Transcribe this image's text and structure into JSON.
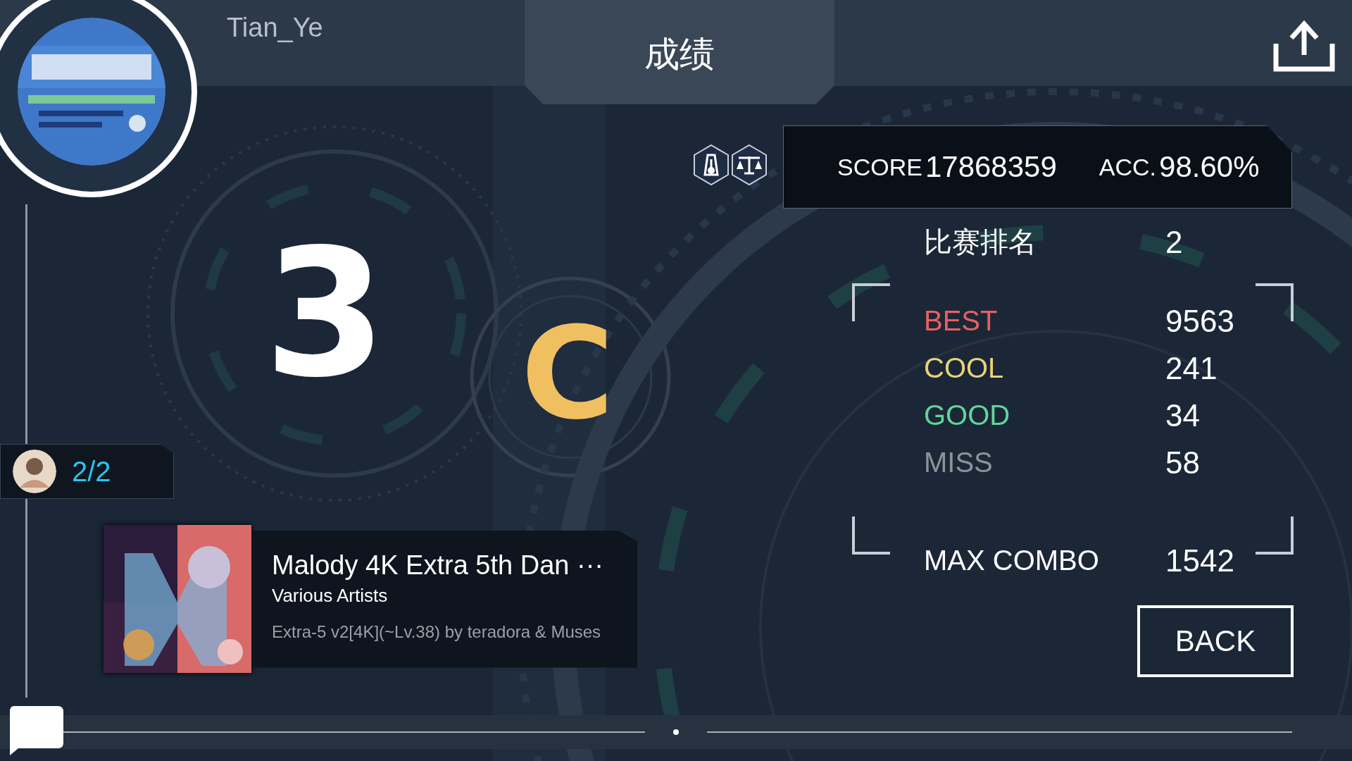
{
  "header": {
    "title": "成绩",
    "username": "Tian_Ye"
  },
  "player": {
    "position": "2/2"
  },
  "rank": "3",
  "grade": "C",
  "score": {
    "label": "SCORE",
    "value": "17868359",
    "acc_label": "ACC.",
    "acc_value": "98.60%"
  },
  "contest_rank": {
    "label": "比赛排名",
    "value": "2"
  },
  "judgements": [
    {
      "label": "BEST",
      "value": "9563",
      "color": "#e8605f"
    },
    {
      "label": "COOL",
      "value": "241",
      "color": "#ead27a"
    },
    {
      "label": "GOOD",
      "value": "34",
      "color": "#62d49c"
    },
    {
      "label": "MISS",
      "value": "58",
      "color": "#8d9299"
    }
  ],
  "max_combo": {
    "label": "MAX COMBO",
    "value": "1542"
  },
  "song": {
    "title": "Malody 4K Extra 5th Dan ···",
    "artist": "Various Artists",
    "chart": "Extra-5 v2[4K](~Lv.38) by teradora & Muses"
  },
  "back_button": "BACK"
}
